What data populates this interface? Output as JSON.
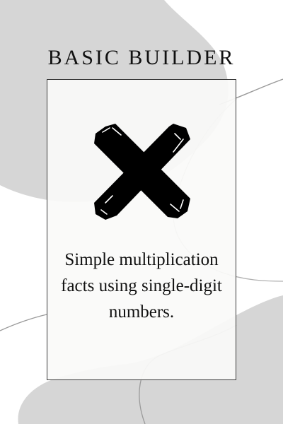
{
  "header": {
    "title": "BASIC BUILDER"
  },
  "card": {
    "icon": "multiplication-x-icon",
    "description": "Simple multiplication facts using single-digit numbers."
  },
  "colors": {
    "background": "#ffffff",
    "blob": "#d6d6d6",
    "card_background": "#faf9f8",
    "card_border": "#3a3a3a",
    "icon": "#000000",
    "text": "#111111",
    "line": "#9a9a9a"
  }
}
